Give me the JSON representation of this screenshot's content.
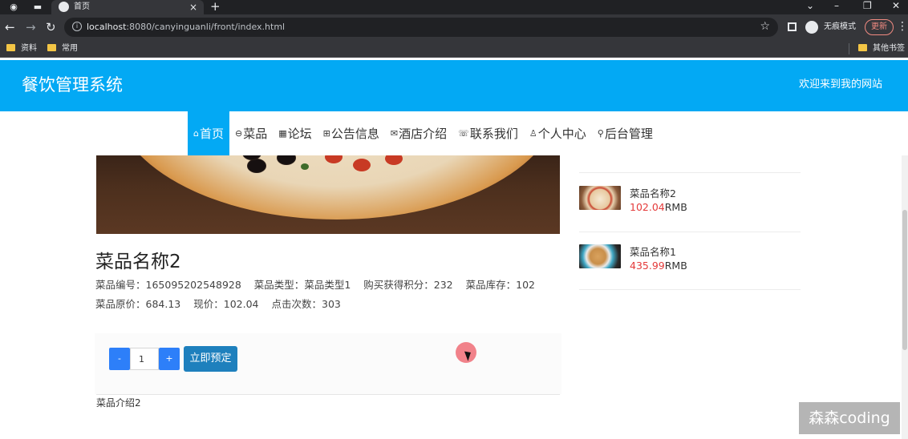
{
  "browser": {
    "tab_title": "首页",
    "url_host": "localhost",
    "url_rest": ":8080/canyinguanli/front/index.html",
    "incognito_label": "无痕模式",
    "update_label": "更新",
    "bookmarks": [
      "资料",
      "常用"
    ],
    "other_bookmarks": "其他书签"
  },
  "header": {
    "title": "餐饮管理系统",
    "welcome": "欢迎来到我的网站"
  },
  "nav": [
    {
      "icon": "⌂",
      "label": "首页"
    },
    {
      "icon": "⊖",
      "label": "菜品"
    },
    {
      "icon": "▦",
      "label": "论坛"
    },
    {
      "icon": "⊞",
      "label": "公告信息"
    },
    {
      "icon": "✉",
      "label": "酒店介绍"
    },
    {
      "icon": "☏",
      "label": "联系我们"
    },
    {
      "icon": "♙",
      "label": "个人中心"
    },
    {
      "icon": "⚲",
      "label": "后台管理"
    }
  ],
  "dish": {
    "name": "菜品名称2",
    "code_label": "菜品编号：",
    "code": "165095202548928",
    "type_label": "菜品类型：",
    "type": "菜品类型1",
    "points_label": "购买获得积分：",
    "points": "232",
    "stock_label": "菜品库存：",
    "stock": "102",
    "orig_price_label": "菜品原价：",
    "orig_price": "684.13",
    "price_label": "现价：",
    "price": "102.04",
    "clicks_label": "点击次数：",
    "clicks": "303",
    "intro": "菜品介绍2"
  },
  "order": {
    "minus": "-",
    "quantity": "1",
    "plus": "+",
    "book_label": "立即预定"
  },
  "sidebar": {
    "items": [
      {
        "name": "菜品名称2",
        "price": "102.04",
        "unit": "RMB"
      },
      {
        "name": "菜品名称1",
        "price": "435.99",
        "unit": "RMB"
      }
    ]
  },
  "watermark": "森森coding",
  "colors": {
    "primary": "#03a9f4",
    "qty_button": "#2d7ff9",
    "book_button": "#1e80bd",
    "price_red": "#e43a3a"
  }
}
